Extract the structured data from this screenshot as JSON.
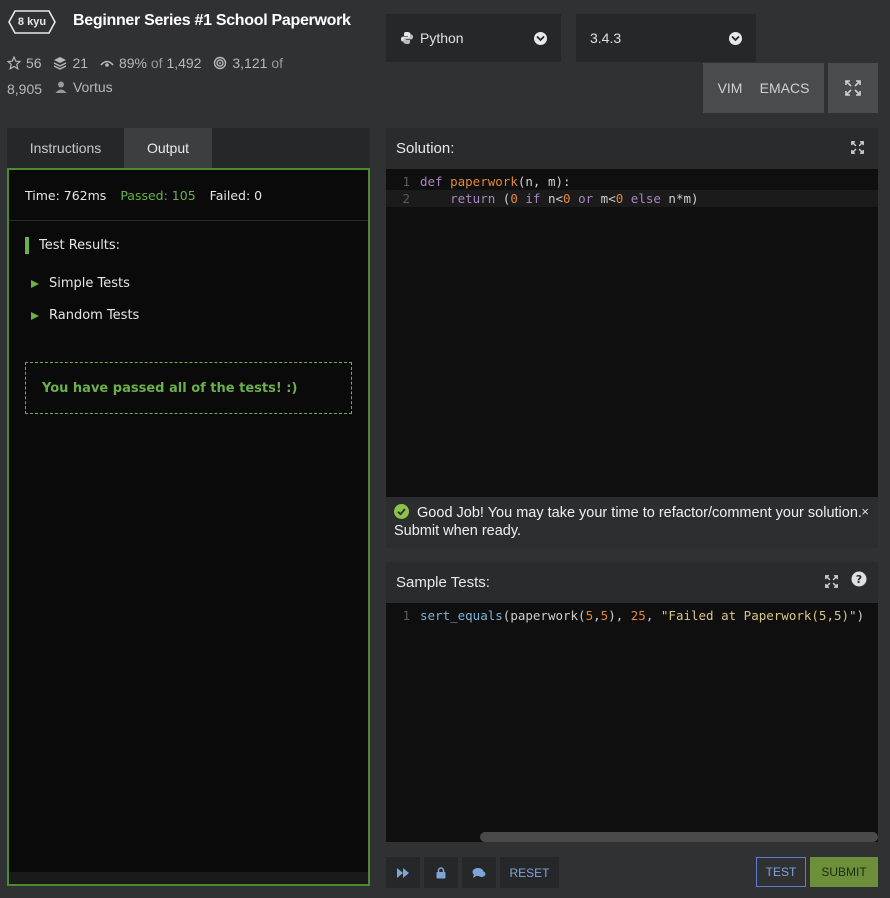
{
  "header": {
    "kyu": "8 kyu",
    "title": "Beginner Series #1 School Paperwork",
    "stats": {
      "stars": "56",
      "collections": "21",
      "satisfaction": "89%",
      "satisfaction_of": "of",
      "votes": "1,492",
      "completed": "3,121",
      "completed_of": "of",
      "attempts": "8,905",
      "author": "Vortus"
    }
  },
  "language_select": {
    "value": "Python",
    "icon": "python-icon"
  },
  "version_select": {
    "value": "3.4.3"
  },
  "keymap": {
    "vim": "VIM",
    "emacs": "EMACS"
  },
  "left_tabs": [
    {
      "label": "Instructions"
    },
    {
      "label": "Output"
    }
  ],
  "output": {
    "time": "Time: 762ms",
    "passed": "Passed: 105",
    "failed": "Failed: 0",
    "results_heading": "Test Results:",
    "groups": [
      "Simple Tests",
      "Random Tests"
    ],
    "passed_message": "You have passed all of the tests! :)"
  },
  "solution": {
    "title": "Solution:",
    "line_numbers": [
      "1",
      "2"
    ]
  },
  "toast": {
    "message": "Good Job! You may take your time to refactor/comment your solution. Submit when ready.",
    "close": "×"
  },
  "sample_tests": {
    "title": "Sample Tests:",
    "line_numbers": [
      "1"
    ]
  },
  "bottom": {
    "reset": "RESET",
    "test": "TEST",
    "submit": "SUBMIT"
  },
  "colors": {
    "accent_green": "#6ab04c",
    "submit_green": "#6e8f3a",
    "link_blue": "#7fa4d8"
  }
}
